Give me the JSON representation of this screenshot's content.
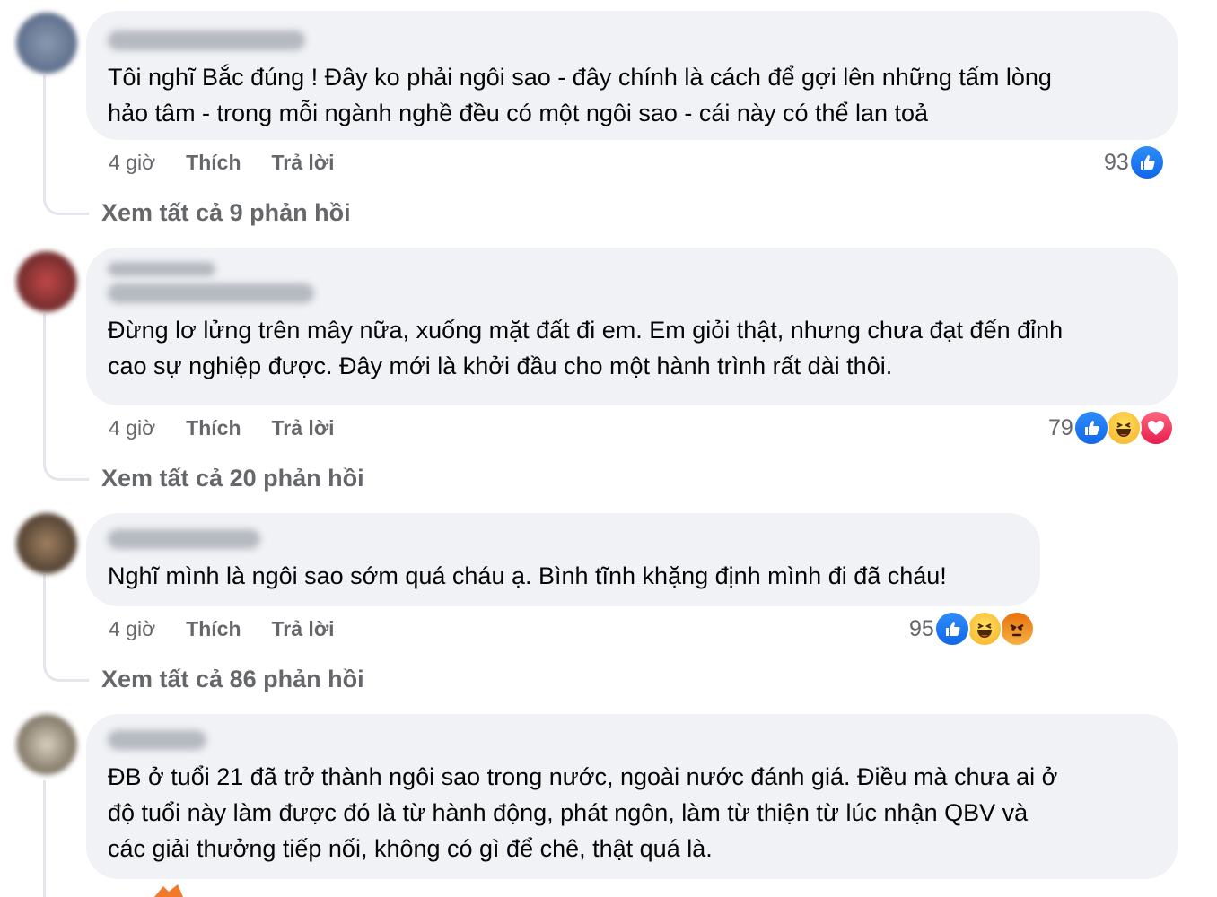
{
  "comments": [
    {
      "text": "Tôi nghĩ Bắc đúng ! Đây ko phải ngôi sao - đây chính là cách để gợi lên những tấm lòng\nhảo tâm - trong mỗi ngành nghề đều có một ngôi sao - cái này có thể lan toả",
      "time": "4 giờ",
      "like_label": "Thích",
      "reply_label": "Trả lời",
      "reaction_count": "93",
      "reactions": [
        "like-icon"
      ],
      "view_replies": "Xem tất cả 9 phản hồi"
    },
    {
      "text": "Đừng lơ lửng trên mây nữa, xuống mặt đất đi em. Em giỏi thật, nhưng chưa đạt đến đỉnh\ncao sự nghiệp được. Đây mới là khởi đầu cho một hành trình rất dài thôi.",
      "time": "4 giờ",
      "like_label": "Thích",
      "reply_label": "Trả lời",
      "reaction_count": "79",
      "reactions": [
        "like-icon",
        "haha-icon",
        "love-icon"
      ],
      "view_replies": "Xem tất cả 20 phản hồi"
    },
    {
      "text": "Nghĩ mình là ngôi sao sớm quá cháu ạ. Bình tĩnh khặng định mình đi đã cháu!",
      "time": "4 giờ",
      "like_label": "Thích",
      "reply_label": "Trả lời",
      "reaction_count": "95",
      "reactions": [
        "like-icon",
        "haha-icon",
        "angry-icon"
      ],
      "view_replies": "Xem tất cả 86 phản hồi"
    },
    {
      "text": "ĐB ở tuổi 21 đã trở thành ngôi sao trong nước, ngoài nước đánh giá. Điều mà chưa ai ở\nđộ tuổi này làm được đó là từ hành động, phát ngôn, làm từ thiện từ lúc nhận QBV và\ncác giải thưởng tiếp nối, không có gì để chê, thật quá là."
    }
  ],
  "colors": {
    "bubble": "#f0f2f5",
    "secondary_text": "#65676b",
    "like": "#1877f2"
  }
}
